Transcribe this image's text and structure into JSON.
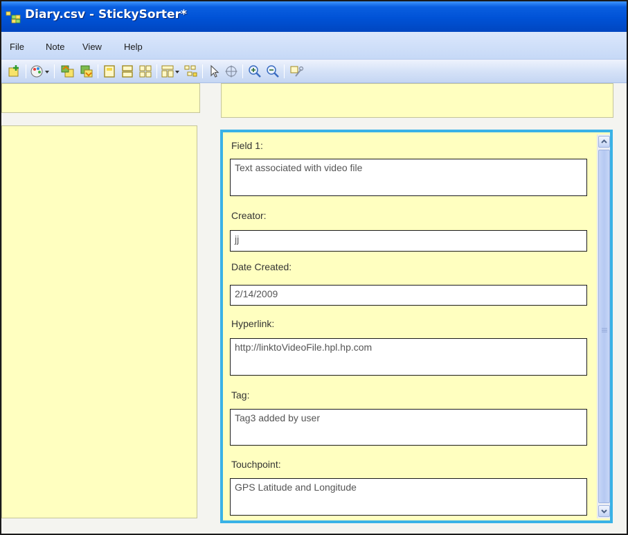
{
  "window": {
    "title": "Diary.csv - StickySorter*"
  },
  "menubar": {
    "items": [
      {
        "label": "File"
      },
      {
        "label": "Note"
      },
      {
        "label": "View"
      },
      {
        "label": "Help"
      }
    ]
  },
  "toolbar": {
    "buttons": [
      "new-note-icon",
      "color-icon",
      "move-up-icon",
      "move-down-icon",
      "single-view-icon",
      "row-view-icon",
      "grid-view-icon",
      "arrange-icon",
      "group-icon",
      "pointer-icon",
      "pan-icon",
      "zoom-in-icon",
      "zoom-out-icon",
      "tools-icon"
    ]
  },
  "note": {
    "fields": [
      {
        "label": "Field 1:",
        "value": "Text associated with video file"
      },
      {
        "label": "Creator:",
        "value": "jj"
      },
      {
        "label": "Date Created:",
        "value": "2/14/2009"
      },
      {
        "label": "Hyperlink:",
        "value": "http://linktoVideoFile.hpl.hp.com"
      },
      {
        "label": "Tag:",
        "value": "Tag3 added by user"
      },
      {
        "label": "Touchpoint:",
        "value": "GPS Latitude and Longitude"
      }
    ]
  },
  "colors": {
    "note_background": "#ffffc0",
    "selected_border": "#3ab2e6",
    "titlebar": "#0052d6"
  }
}
